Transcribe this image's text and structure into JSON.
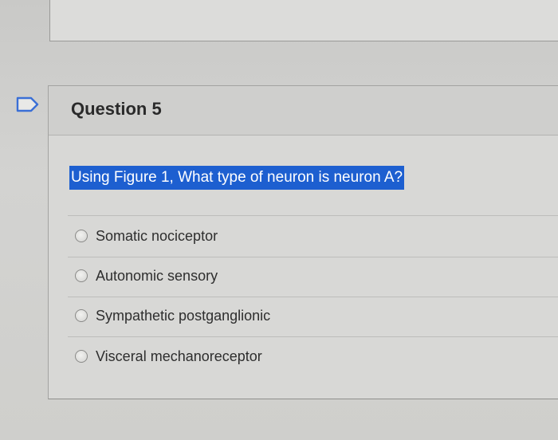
{
  "question": {
    "title": "Question 5",
    "prompt": "Using Figure 1, What type of neuron is neuron A?",
    "options": [
      {
        "label": "Somatic nociceptor",
        "selected": false
      },
      {
        "label": "Autonomic sensory",
        "selected": false
      },
      {
        "label": "Sympathetic postganglionic",
        "selected": false
      },
      {
        "label": "Visceral mechanoreceptor",
        "selected": false
      }
    ]
  },
  "icons": {
    "flag": "flag-icon",
    "radio": "radio-button-icon"
  },
  "colors": {
    "prompt_highlight": "#1d5fd0",
    "prompt_text": "#ffffff"
  }
}
